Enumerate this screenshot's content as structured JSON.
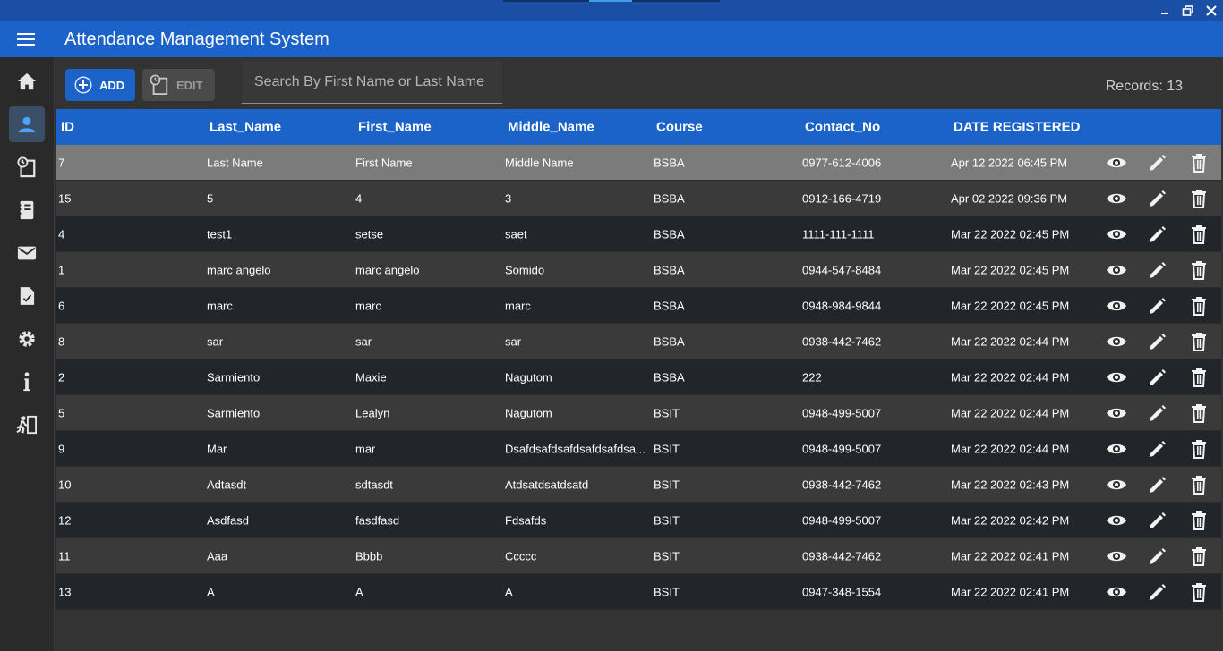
{
  "app": {
    "title": "Attendance Management System"
  },
  "sidebar": {
    "items": [
      {
        "icon": "home-icon",
        "active": false
      },
      {
        "icon": "person-icon",
        "active": true
      },
      {
        "icon": "clock-document-icon",
        "active": false
      },
      {
        "icon": "book-icon",
        "active": false
      },
      {
        "icon": "mail-icon",
        "active": false
      },
      {
        "icon": "report-icon",
        "active": false
      },
      {
        "icon": "gear-icon",
        "active": false
      },
      {
        "icon": "info-icon",
        "active": false
      },
      {
        "icon": "exit-icon",
        "active": false
      }
    ]
  },
  "toolbar": {
    "add_label": "ADD",
    "edit_label": "EDIT",
    "search_placeholder": "Search By First Name or Last Name",
    "records_label": "Records: 13"
  },
  "colors": {
    "accent": "#1c63c9",
    "row_dark": "#22262b",
    "row_light": "#3a3a3a",
    "row_selected": "#7b7b7b"
  },
  "table": {
    "columns": [
      "ID",
      "Last_Name",
      "First_Name",
      "Middle_Name",
      "Course",
      "Contact_No",
      "DATE REGISTERED"
    ],
    "rows": [
      [
        "7",
        "Last Name",
        "First Name",
        "Middle Name",
        "BSBA",
        "0977-612-4006",
        "Apr 12 2022 06:45 PM"
      ],
      [
        "15",
        "5",
        "4",
        "3",
        "BSBA",
        "0912-166-4719",
        "Apr 02 2022 09:36 PM"
      ],
      [
        "4",
        "test1",
        "setse",
        "saet",
        "BSBA",
        "1111-111-1111",
        "Mar 22 2022 02:45 PM"
      ],
      [
        "1",
        "marc angelo",
        "marc angelo",
        "Somido",
        "BSBA",
        "0944-547-8484",
        "Mar 22 2022 02:45 PM"
      ],
      [
        "6",
        "marc",
        "marc",
        "marc",
        "BSBA",
        "0948-984-9844",
        "Mar 22 2022 02:45 PM"
      ],
      [
        "8",
        "sar",
        "sar",
        "sar",
        "BSBA",
        "0938-442-7462",
        "Mar 22 2022 02:44 PM"
      ],
      [
        "2",
        "Sarmiento",
        "Maxie",
        "Nagutom",
        "BSBA",
        "222",
        "Mar 22 2022 02:44 PM"
      ],
      [
        "5",
        "Sarmiento",
        "Lealyn",
        "Nagutom",
        "BSIT",
        "0948-499-5007",
        "Mar 22 2022 02:44 PM"
      ],
      [
        "9",
        "Mar",
        "mar",
        "Dsafdsafdsafdsafdsafdsa...",
        "BSIT",
        "0948-499-5007",
        "Mar 22 2022 02:44 PM"
      ],
      [
        "10",
        "Adtasdt",
        "sdtasdt",
        "Atdsatdsatdsatd",
        "BSIT",
        "0938-442-7462",
        "Mar 22 2022 02:43 PM"
      ],
      [
        "12",
        "Asdfasd",
        "fasdfasd",
        "Fdsafds",
        "BSIT",
        "0948-499-5007",
        "Mar 22 2022 02:42 PM"
      ],
      [
        "11",
        "Aaa",
        "Bbbb",
        "Ccccc",
        "BSIT",
        "0938-442-7462",
        "Mar 22 2022 02:41 PM"
      ],
      [
        "13",
        "A",
        "A",
        "A",
        "BSIT",
        "0947-348-1554",
        "Mar 22 2022 02:41 PM"
      ]
    ],
    "selected_row": 0
  }
}
